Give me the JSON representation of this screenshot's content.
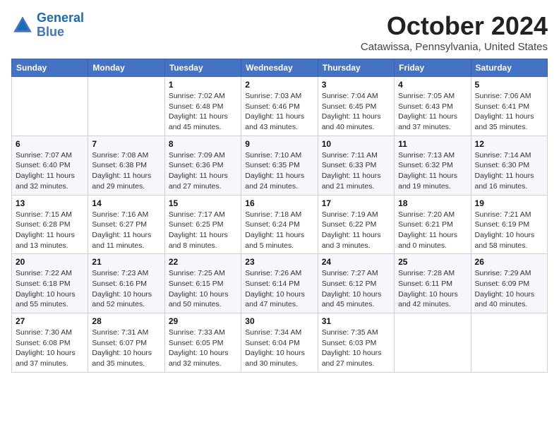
{
  "header": {
    "logo_line1": "General",
    "logo_line2": "Blue",
    "month_title": "October 2024",
    "subtitle": "Catawissa, Pennsylvania, United States"
  },
  "weekdays": [
    "Sunday",
    "Monday",
    "Tuesday",
    "Wednesday",
    "Thursday",
    "Friday",
    "Saturday"
  ],
  "weeks": [
    [
      {
        "day": "",
        "info": ""
      },
      {
        "day": "",
        "info": ""
      },
      {
        "day": "1",
        "info": "Sunrise: 7:02 AM\nSunset: 6:48 PM\nDaylight: 11 hours and 45 minutes."
      },
      {
        "day": "2",
        "info": "Sunrise: 7:03 AM\nSunset: 6:46 PM\nDaylight: 11 hours and 43 minutes."
      },
      {
        "day": "3",
        "info": "Sunrise: 7:04 AM\nSunset: 6:45 PM\nDaylight: 11 hours and 40 minutes."
      },
      {
        "day": "4",
        "info": "Sunrise: 7:05 AM\nSunset: 6:43 PM\nDaylight: 11 hours and 37 minutes."
      },
      {
        "day": "5",
        "info": "Sunrise: 7:06 AM\nSunset: 6:41 PM\nDaylight: 11 hours and 35 minutes."
      }
    ],
    [
      {
        "day": "6",
        "info": "Sunrise: 7:07 AM\nSunset: 6:40 PM\nDaylight: 11 hours and 32 minutes."
      },
      {
        "day": "7",
        "info": "Sunrise: 7:08 AM\nSunset: 6:38 PM\nDaylight: 11 hours and 29 minutes."
      },
      {
        "day": "8",
        "info": "Sunrise: 7:09 AM\nSunset: 6:36 PM\nDaylight: 11 hours and 27 minutes."
      },
      {
        "day": "9",
        "info": "Sunrise: 7:10 AM\nSunset: 6:35 PM\nDaylight: 11 hours and 24 minutes."
      },
      {
        "day": "10",
        "info": "Sunrise: 7:11 AM\nSunset: 6:33 PM\nDaylight: 11 hours and 21 minutes."
      },
      {
        "day": "11",
        "info": "Sunrise: 7:13 AM\nSunset: 6:32 PM\nDaylight: 11 hours and 19 minutes."
      },
      {
        "day": "12",
        "info": "Sunrise: 7:14 AM\nSunset: 6:30 PM\nDaylight: 11 hours and 16 minutes."
      }
    ],
    [
      {
        "day": "13",
        "info": "Sunrise: 7:15 AM\nSunset: 6:28 PM\nDaylight: 11 hours and 13 minutes."
      },
      {
        "day": "14",
        "info": "Sunrise: 7:16 AM\nSunset: 6:27 PM\nDaylight: 11 hours and 11 minutes."
      },
      {
        "day": "15",
        "info": "Sunrise: 7:17 AM\nSunset: 6:25 PM\nDaylight: 11 hours and 8 minutes."
      },
      {
        "day": "16",
        "info": "Sunrise: 7:18 AM\nSunset: 6:24 PM\nDaylight: 11 hours and 5 minutes."
      },
      {
        "day": "17",
        "info": "Sunrise: 7:19 AM\nSunset: 6:22 PM\nDaylight: 11 hours and 3 minutes."
      },
      {
        "day": "18",
        "info": "Sunrise: 7:20 AM\nSunset: 6:21 PM\nDaylight: 11 hours and 0 minutes."
      },
      {
        "day": "19",
        "info": "Sunrise: 7:21 AM\nSunset: 6:19 PM\nDaylight: 10 hours and 58 minutes."
      }
    ],
    [
      {
        "day": "20",
        "info": "Sunrise: 7:22 AM\nSunset: 6:18 PM\nDaylight: 10 hours and 55 minutes."
      },
      {
        "day": "21",
        "info": "Sunrise: 7:23 AM\nSunset: 6:16 PM\nDaylight: 10 hours and 52 minutes."
      },
      {
        "day": "22",
        "info": "Sunrise: 7:25 AM\nSunset: 6:15 PM\nDaylight: 10 hours and 50 minutes."
      },
      {
        "day": "23",
        "info": "Sunrise: 7:26 AM\nSunset: 6:14 PM\nDaylight: 10 hours and 47 minutes."
      },
      {
        "day": "24",
        "info": "Sunrise: 7:27 AM\nSunset: 6:12 PM\nDaylight: 10 hours and 45 minutes."
      },
      {
        "day": "25",
        "info": "Sunrise: 7:28 AM\nSunset: 6:11 PM\nDaylight: 10 hours and 42 minutes."
      },
      {
        "day": "26",
        "info": "Sunrise: 7:29 AM\nSunset: 6:09 PM\nDaylight: 10 hours and 40 minutes."
      }
    ],
    [
      {
        "day": "27",
        "info": "Sunrise: 7:30 AM\nSunset: 6:08 PM\nDaylight: 10 hours and 37 minutes."
      },
      {
        "day": "28",
        "info": "Sunrise: 7:31 AM\nSunset: 6:07 PM\nDaylight: 10 hours and 35 minutes."
      },
      {
        "day": "29",
        "info": "Sunrise: 7:33 AM\nSunset: 6:05 PM\nDaylight: 10 hours and 32 minutes."
      },
      {
        "day": "30",
        "info": "Sunrise: 7:34 AM\nSunset: 6:04 PM\nDaylight: 10 hours and 30 minutes."
      },
      {
        "day": "31",
        "info": "Sunrise: 7:35 AM\nSunset: 6:03 PM\nDaylight: 10 hours and 27 minutes."
      },
      {
        "day": "",
        "info": ""
      },
      {
        "day": "",
        "info": ""
      }
    ]
  ]
}
